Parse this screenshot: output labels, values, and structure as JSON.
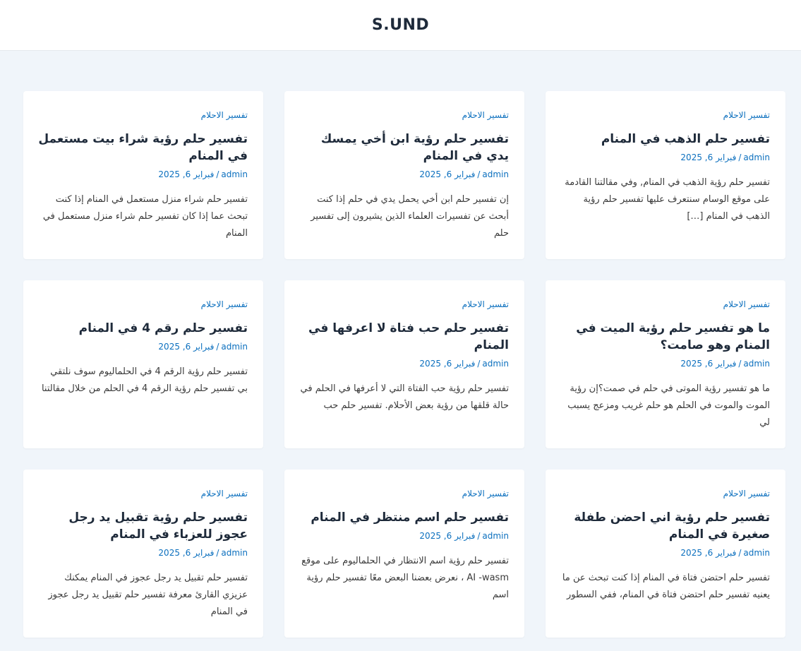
{
  "site": {
    "title": "S.UND"
  },
  "posts": [
    {
      "category": "تفسير الاحلام",
      "title": "تفسير حلم الذهب في المنام",
      "author": "admin",
      "date": "فبراير 6, 2025",
      "excerpt": "تفسير حلم رؤية الذهب في المنام, وفي مقالتنا القادمة على موقع الوسام سنتعرف عليها تفسير حلم رؤية الذهب في المنام […]"
    },
    {
      "category": "تفسير الاحلام",
      "title": "تفسير حلم رؤية ابن أخي يمسك يدي في المنام",
      "author": "admin",
      "date": "فبراير 6, 2025",
      "excerpt": "إن تفسير حلم ابن أخي يحمل يدي في حلم إذا كنت أبحث عن تفسيرات العلماء الذين يشيرون إلى تفسير حلم"
    },
    {
      "category": "تفسير الاحلام",
      "title": "تفسير حلم رؤية شراء بيت مستعمل في المنام",
      "author": "admin",
      "date": "فبراير 6, 2025",
      "excerpt": "تفسير حلم شراء منزل مستعمل في المنام إذا كنت تبحث عما إذا كان تفسير حلم شراء منزل مستعمل في المنام"
    },
    {
      "category": "تفسير الاحلام",
      "title": "ما هو تفسير حلم رؤية الميت في المنام وهو صامت؟",
      "author": "admin",
      "date": "فبراير 6, 2025",
      "excerpt": "ما هو تفسير رؤية الموتى في حلم في صمت؟إن رؤية الموت والموت في الحلم هو حلم غريب ومزعج يسبب لي"
    },
    {
      "category": "تفسير الاحلام",
      "title": "تفسير حلم حب فتاة لا اعرفها في المنام",
      "author": "admin",
      "date": "فبراير 6, 2025",
      "excerpt": "تفسير حلم رؤية حب الفتاة التي لا أعرفها في الحلم في حالة قلقها من رؤية بعض الأحلام. تفسير حلم حب"
    },
    {
      "category": "تفسير الاحلام",
      "title": "تفسير حلم رقم 4 في المنام",
      "author": "admin",
      "date": "فبراير 6, 2025",
      "excerpt": "تفسير حلم رؤية الرقم 4 في الحلماليوم سوف نلتقي بي تفسير حلم رؤية الرقم 4 في الحلم من خلال مقالتنا"
    },
    {
      "category": "تفسير الاحلام",
      "title": "تفسير حلم رؤية اني احضن طفلة صغيرة في المنام",
      "author": "admin",
      "date": "فبراير 6, 2025",
      "excerpt": "تفسير حلم احتضن فتاة في المنام إذا كنت تبحث عن ما يعنيه تفسير حلم احتضن فتاة في المنام، ففي السطور"
    },
    {
      "category": "تفسير الاحلام",
      "title": "تفسير حلم اسم منتظر في المنام",
      "author": "admin",
      "date": "فبراير 6, 2025",
      "excerpt": "تفسير حلم رؤية اسم الانتظار في الحلماليوم على موقع AI -wasm ، نعرض بعضنا البعض معًا تفسير حلم رؤية اسم"
    },
    {
      "category": "تفسير الاحلام",
      "title": "تفسير حلم رؤية تقبيل يد رجل عجوز للعزباء في المنام",
      "author": "admin",
      "date": "فبراير 6, 2025",
      "excerpt": "تفسير حلم تقبيل يد رجل عجوز في المنام يمكنك عزيزي القارئ معرفة تفسير حلم تقبيل يد رجل عجوز في المنام"
    }
  ],
  "colors": {
    "background": "#f0f5fa",
    "accent": "#0b6fbe",
    "heading": "#1e2a3a"
  }
}
